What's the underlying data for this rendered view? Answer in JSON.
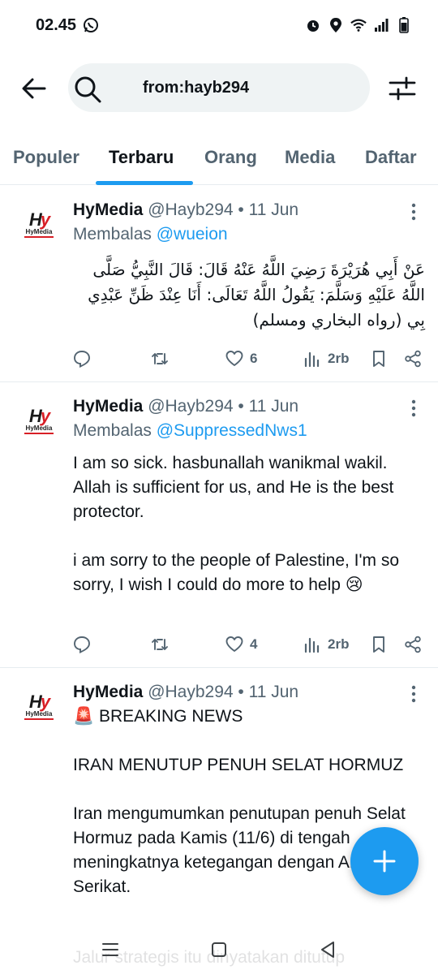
{
  "status_bar": {
    "time": "02.45",
    "icons": [
      "whatsapp-icon",
      "alarm-icon",
      "location-icon",
      "wifi-icon",
      "signal-icon",
      "battery-icon"
    ]
  },
  "search": {
    "query": "from:hayb294"
  },
  "tabs": [
    {
      "label": "Populer"
    },
    {
      "label": "Terbaru",
      "active": true
    },
    {
      "label": "Orang"
    },
    {
      "label": "Media"
    },
    {
      "label": "Daftar"
    }
  ],
  "tweets": [
    {
      "name": "HyMedia",
      "meta": "@Hayb294 • 11 Jun",
      "reply_prefix": "Membalas",
      "reply_handle": "@wueion",
      "text": "عَنْ أَبِي هُرَيْرَةَ رَضِيَ اللَّهُ عَنْهُ قَالَ: قَالَ النَّبِيُّ صَلَّى اللَّهُ عَلَيْهِ وَسَلَّمَ: يَقُولُ اللَّهُ تَعَالَى: أَنَا عِنْدَ ظَنِّ عَبْدِي بِي (رواه البخاري ومسلم)",
      "likes": "6",
      "views": "2rb"
    },
    {
      "name": "HyMedia",
      "meta": "@Hayb294 • 11 Jun",
      "reply_prefix": "Membalas",
      "reply_handle": "@SuppressedNws1",
      "text": "I am so sick. hasbunallah wanikmal wakil. Allah is sufficient for us, and He is the best protector.\n\ni am sorry to the people of Palestine, I'm so sorry, I wish I could do more to help 😢",
      "likes": "4",
      "views": "2rb"
    },
    {
      "name": "HyMedia",
      "meta": "@Hayb294 • 11 Jun",
      "text": "🚨 BREAKING NEWS\n\nIRAN MENUTUP PENUH SELAT HORMUZ\n\nIran mengumumkan penutupan penuh Selat Hormuz pada Kamis (11/6) di tengah meningkatnya ketegangan dengan Amerika Serikat.",
      "faded_text": "Jalur strategis itu dinyatakan ditutup"
    }
  ],
  "avatar_logo": {
    "mark": "Hy",
    "caption": "HyMedia"
  },
  "colors": {
    "accent": "#1d9bf0",
    "text": "#0f1419",
    "muted": "#536471",
    "logo_red": "#d81f26"
  }
}
